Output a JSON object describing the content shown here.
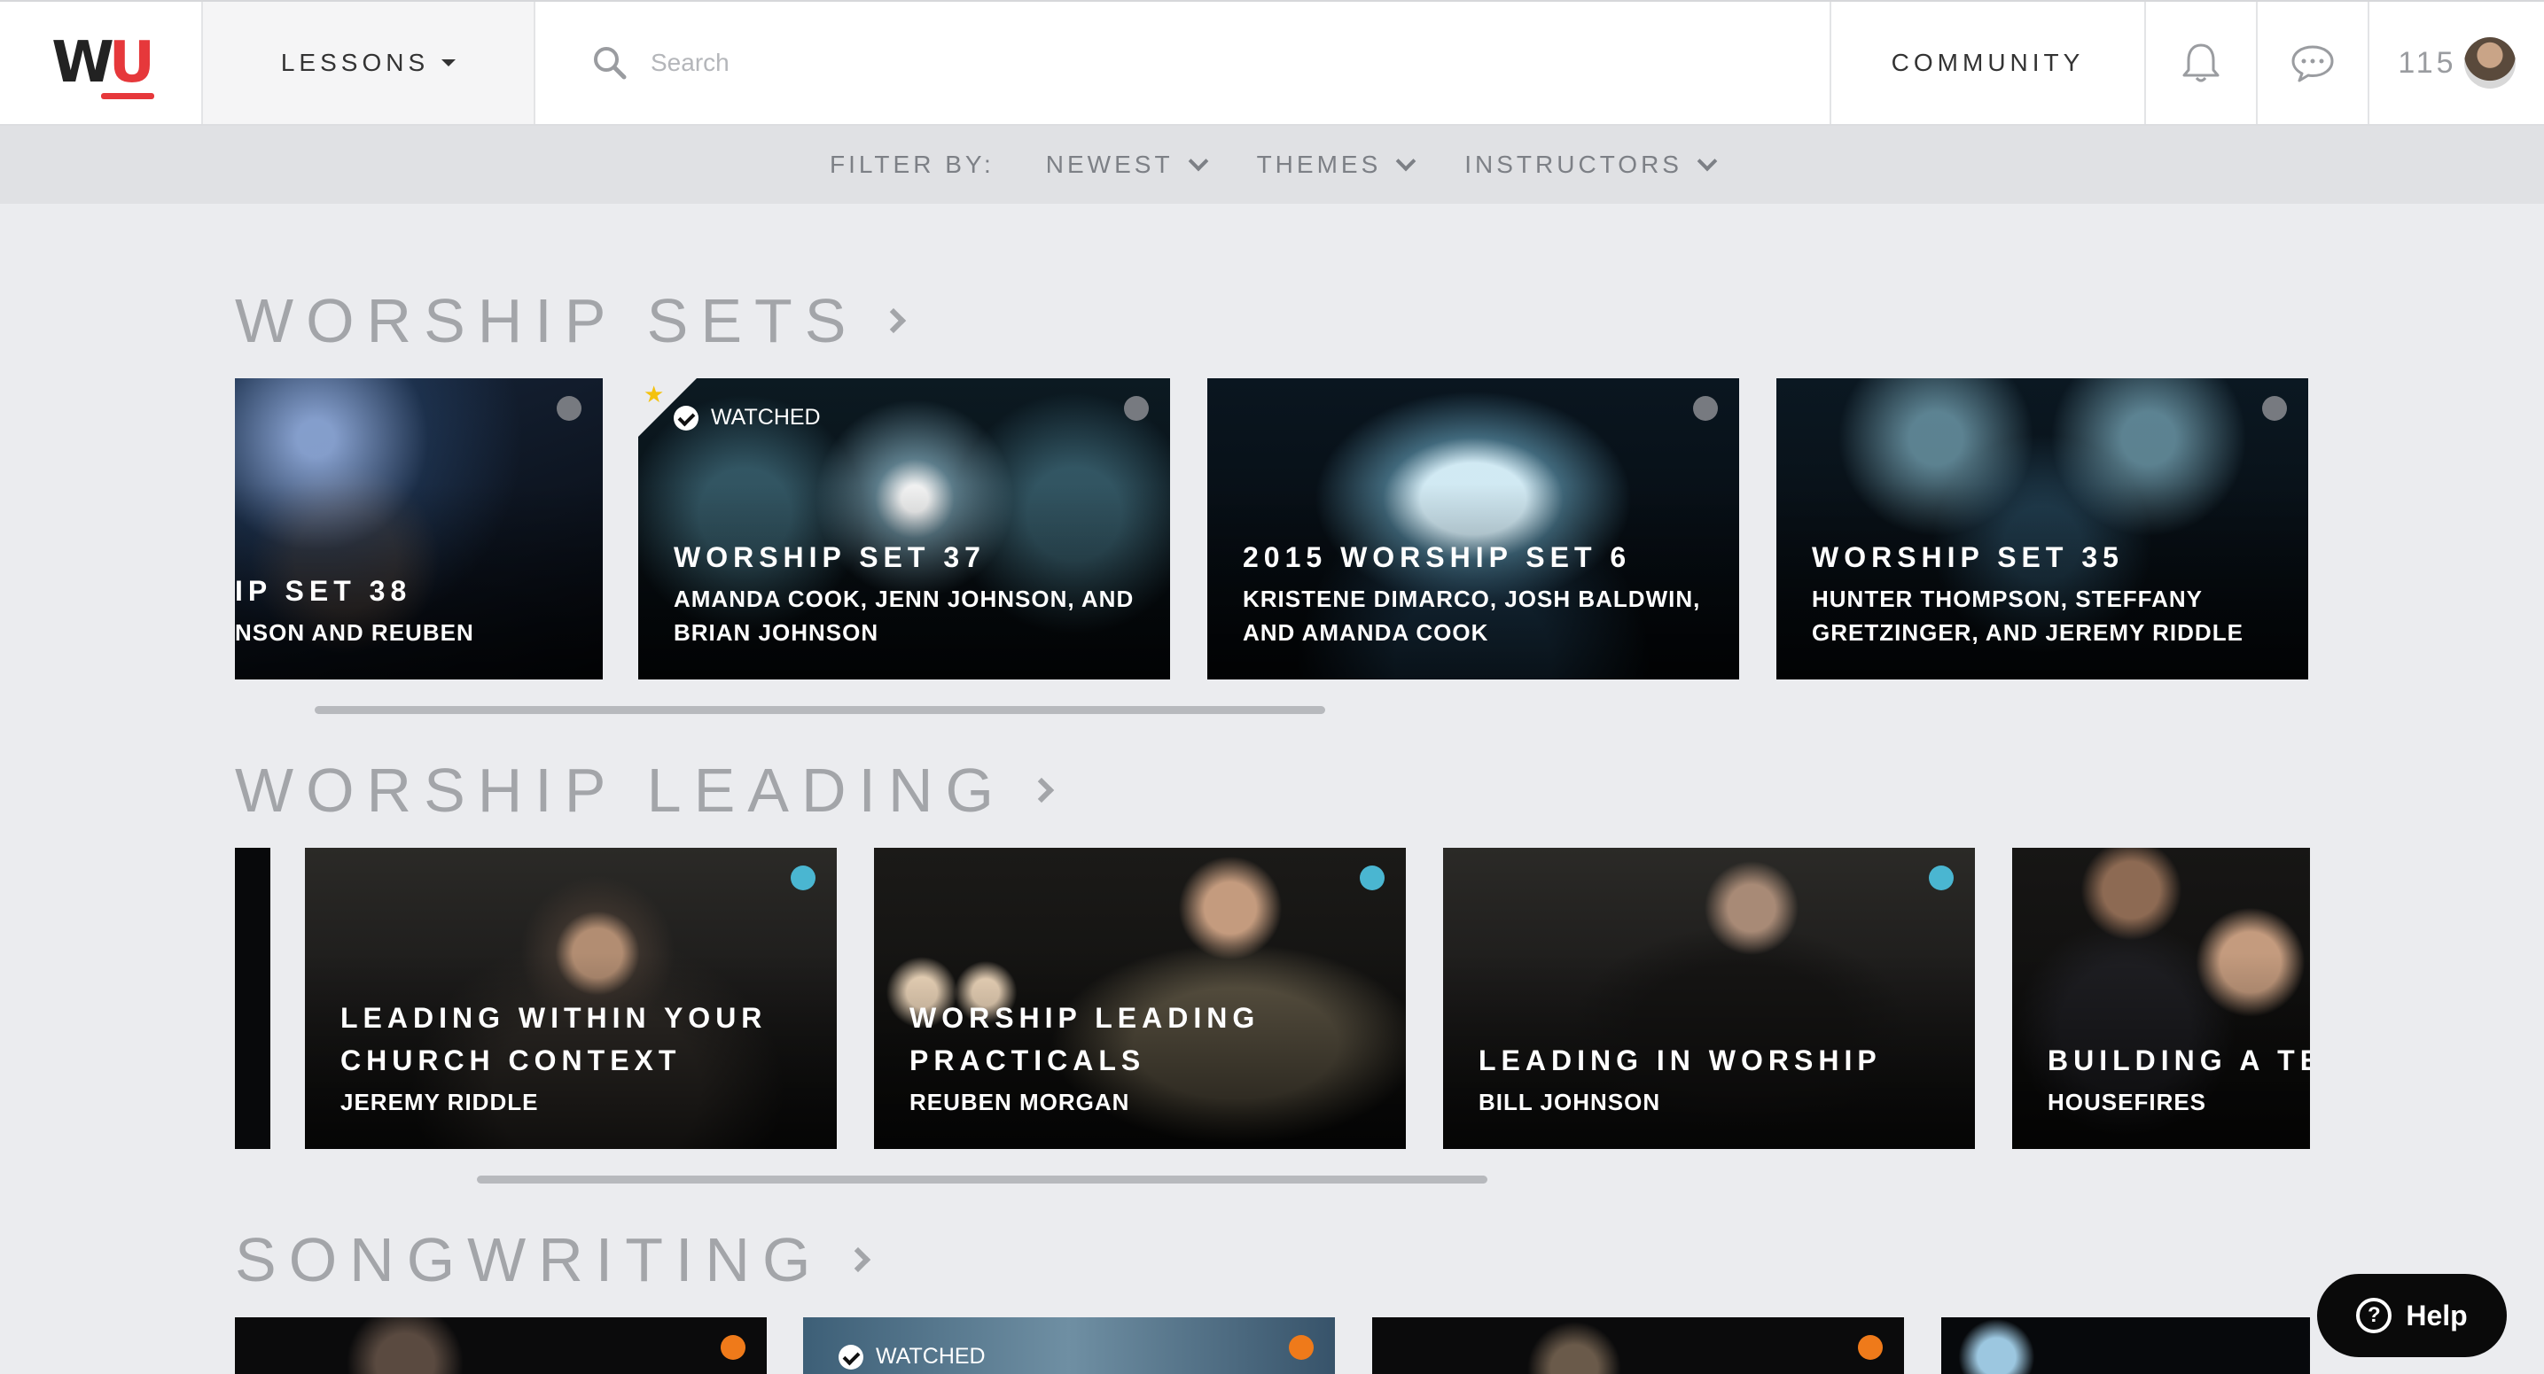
{
  "nav": {
    "logo_w": "W",
    "logo_u": "U",
    "lessons_label": "LESSONS",
    "search_placeholder": "Search",
    "community_label": "COMMUNITY",
    "points": "115"
  },
  "filters": {
    "label": "FILTER BY:",
    "items": [
      "NEWEST",
      "THEMES",
      "INSTRUCTORS"
    ]
  },
  "sections": [
    {
      "title": "WORSHIP SETS",
      "cards": [
        {
          "title": "IP SET 38",
          "subtitle": "NSON AND REUBEN",
          "dot": "gray"
        },
        {
          "title": "WORSHIP SET 37",
          "subtitle": "AMANDA COOK, JENN JOHNSON, AND BRIAN JOHNSON",
          "dot": "gray",
          "watched": "WATCHED"
        },
        {
          "title": "2015 WORSHIP SET 6",
          "subtitle": "KRISTENE DIMARCO, JOSH BALDWIN, AND AMANDA COOK",
          "dot": "gray"
        },
        {
          "title": "WORSHIP SET 35",
          "subtitle": "HUNTER THOMPSON, STEFFANY GRETZINGER, AND JEREMY RIDDLE",
          "dot": "gray"
        }
      ]
    },
    {
      "title": "WORSHIP LEADING",
      "cards": [
        {
          "title": "LEADING WITHIN YOUR CHURCH CONTEXT",
          "subtitle": "JEREMY RIDDLE",
          "dot": "blue"
        },
        {
          "title": "WORSHIP LEADING PRACTICALS",
          "subtitle": "REUBEN MORGAN",
          "dot": "blue"
        },
        {
          "title": "LEADING IN WORSHIP",
          "subtitle": "BILL JOHNSON",
          "dot": "blue"
        },
        {
          "title": "BUILDING A TE",
          "subtitle": "HOUSEFIRES",
          "dot": "none"
        }
      ]
    },
    {
      "title": "SONGWRITING",
      "cards": [
        {
          "dot": "orange"
        },
        {
          "watched": "WATCHED",
          "dot": "orange"
        },
        {
          "dot": "orange"
        },
        {
          "dot": "none"
        }
      ]
    }
  ],
  "help_label": "Help",
  "colors": {
    "brand_red": "#e6383b",
    "unwatched_dot": "#777a80",
    "leading_dot": "#4ab6d1",
    "songwriting_dot": "#ef7a1a",
    "star": "#f4c20d"
  }
}
